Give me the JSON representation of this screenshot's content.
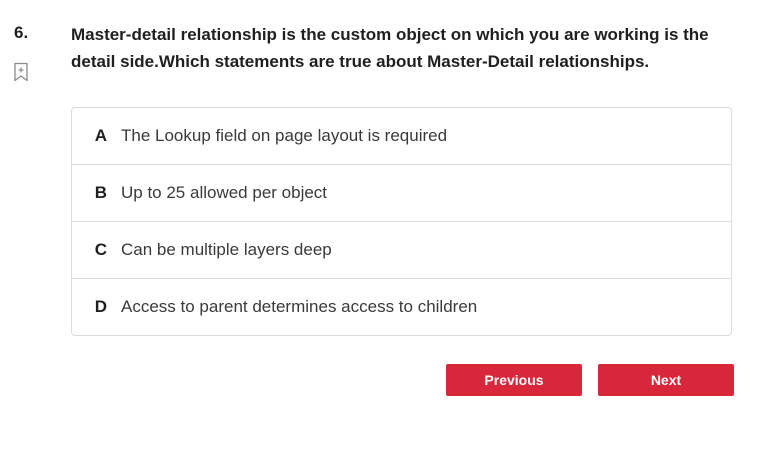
{
  "question": {
    "number": "6.",
    "text": "Master-detail relationship is the custom object on which you are working is the detail side.Which statements are true about Master-Detail relationships."
  },
  "options": [
    {
      "letter": "A",
      "text": "The Lookup field on page layout is required"
    },
    {
      "letter": "B",
      "text": "Up to 25 allowed per object"
    },
    {
      "letter": "C",
      "text": "Can be multiple layers deep"
    },
    {
      "letter": "D",
      "text": "Access to parent determines access to children"
    }
  ],
  "navigation": {
    "previous_label": "Previous",
    "next_label": "Next"
  },
  "colors": {
    "button": "#d8263b",
    "border": "#dcdcdc",
    "bookmark": "#8a8a8a"
  },
  "icons": {
    "bookmark": "bookmark-plus-icon"
  }
}
